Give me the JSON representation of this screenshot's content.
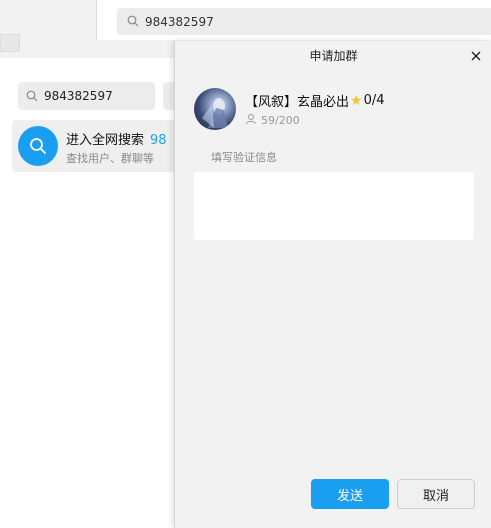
{
  "back_window": {
    "search_value": "984382597"
  },
  "middle_window": {
    "search_value": "984382597",
    "global_search": {
      "title": "进入全网搜索",
      "highlight": "98",
      "subtitle": "查找用户、群聊等"
    }
  },
  "dialog": {
    "title": "申请加群",
    "group": {
      "name_prefix": "【风叙】玄晶必出",
      "star_icon": "★",
      "name_suffix": "0/4",
      "members": "59/200"
    },
    "verify_label": "填写验证信息",
    "verify_value": "",
    "send_label": "发送",
    "cancel_label": "取消"
  },
  "colors": {
    "accent": "#1a9ff0",
    "star": "#f3c23c"
  }
}
